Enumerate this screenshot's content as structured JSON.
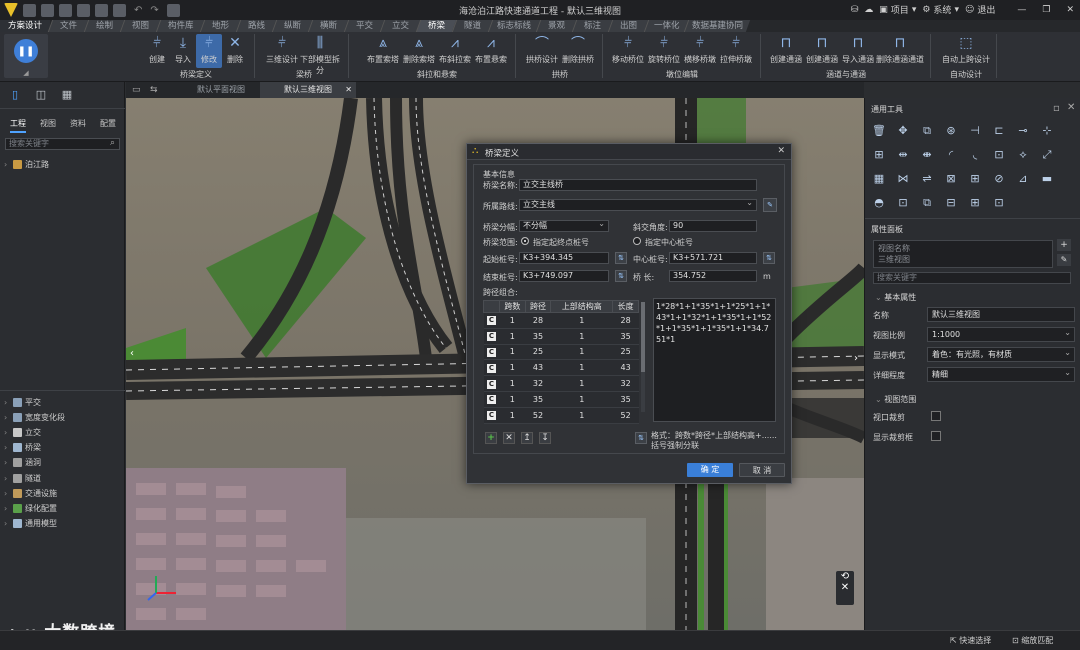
{
  "app": {
    "title": "海沧泊江路快速通道工程 - 默认三维视图"
  },
  "titlebar": {
    "project": "项目",
    "system": "系统",
    "logout": "退出"
  },
  "menu_tabs": [
    "方案设计",
    "文件",
    "绘制",
    "视图",
    "构件库",
    "地形",
    "路线",
    "纵断",
    "横断",
    "平交",
    "立交",
    "桥梁",
    "隧道",
    "标志标线",
    "景观",
    "标注",
    "出图",
    "一体化",
    "数据基建协同"
  ],
  "ribbon": {
    "groups": [
      {
        "label": "桥梁定义",
        "buttons": [
          "创建",
          "导入",
          "修改",
          "删除"
        ]
      },
      {
        "label": "梁桥",
        "buttons": [
          "三维设计",
          "下部模型拆分"
        ]
      },
      {
        "label": "斜拉和悬索",
        "buttons": [
          "布置索塔",
          "删除索塔",
          "布斜拉索",
          "布置悬索"
        ]
      },
      {
        "label": "拱桥",
        "buttons": [
          "拱桥设计",
          "删除拱桥"
        ]
      },
      {
        "label": "墩位编辑",
        "buttons": [
          "移动桥位",
          "旋转桥位",
          "横移桥墩",
          "拉伸桥墩"
        ]
      },
      {
        "label": "涵道与通涵",
        "buttons": [
          "创建通涵",
          "创建通涵",
          "导入通涵",
          "删除通涵通道"
        ]
      },
      {
        "label": "自动设计",
        "buttons": [
          "自动上跨设计"
        ]
      }
    ]
  },
  "left": {
    "tabs": [
      "工程",
      "视图",
      "资料",
      "配置"
    ],
    "search_placeholder": "搜索关键字",
    "tree_root": "泊江路",
    "lower_tree": [
      "平交",
      "宽度变化段",
      "立交",
      "桥梁",
      "涵洞",
      "隧道",
      "交通设施",
      "绿化配置",
      "通用模型"
    ]
  },
  "view_tabs": [
    "默认平面视图",
    "默认三维视图"
  ],
  "right": {
    "tools_title": "通用工具",
    "props_title": "属性面板",
    "props_dropdown": [
      "视图名称",
      "三维视图"
    ],
    "props_search": "搜索关键字",
    "section_basic": "基本属性",
    "props": [
      {
        "key": "名称",
        "value": "默认三维视图"
      },
      {
        "key": "视图比例",
        "value": "1:1000"
      },
      {
        "key": "显示模式",
        "value": "着色：有光照，有材质"
      },
      {
        "key": "详细程度",
        "value": "精细"
      }
    ],
    "section_range": "视图范围",
    "range": [
      "视口裁剪",
      "显示裁剪框"
    ]
  },
  "status": {
    "quick_select": "快速选择",
    "zoom": "缩放匹配"
  },
  "watermark": "大数跨境",
  "dialog": {
    "title": "桥梁定义",
    "basic": "基本信息",
    "name_label": "桥梁名称:",
    "name_value": "立交主线桥",
    "route_label": "所属路线:",
    "route_value": "立交主线",
    "split_label": "桥梁分幅:",
    "split_value": "不分幅",
    "skew_label": "斜交角度:",
    "skew_value": "90",
    "range_label": "桥梁范围:",
    "range_opt1": "指定起终点桩号",
    "range_opt2": "指定中心桩号",
    "start_label": "起始桩号:",
    "start_value": "K3+394.345",
    "center_label": "中心桩号:",
    "center_value": "K3+571.721",
    "end_label": "结束桩号:",
    "end_value": "K3+749.097",
    "len_label": "桥 长:",
    "len_value": "354.752",
    "len_unit": "m",
    "spans_label": "跨径组合:",
    "columns": [
      "跨数",
      "跨径",
      "上部结构高",
      "长度"
    ],
    "rows": [
      [
        "1",
        "28",
        "1",
        "28"
      ],
      [
        "1",
        "35",
        "1",
        "35"
      ],
      [
        "1",
        "25",
        "1",
        "25"
      ],
      [
        "1",
        "43",
        "1",
        "43"
      ],
      [
        "1",
        "32",
        "1",
        "32"
      ],
      [
        "1",
        "35",
        "1",
        "35"
      ],
      [
        "1",
        "52",
        "1",
        "52"
      ]
    ],
    "formula": "1*28*1+1*35*1+1*25*1+1*43*1+1*32*1+1*35*1+1*52*1+1*35*1+1*35*1+1*34.751*1",
    "hint": "格式：跨数*跨径*上部结构高+......括号强制分联",
    "ok": "确 定",
    "cancel": "取 消"
  }
}
